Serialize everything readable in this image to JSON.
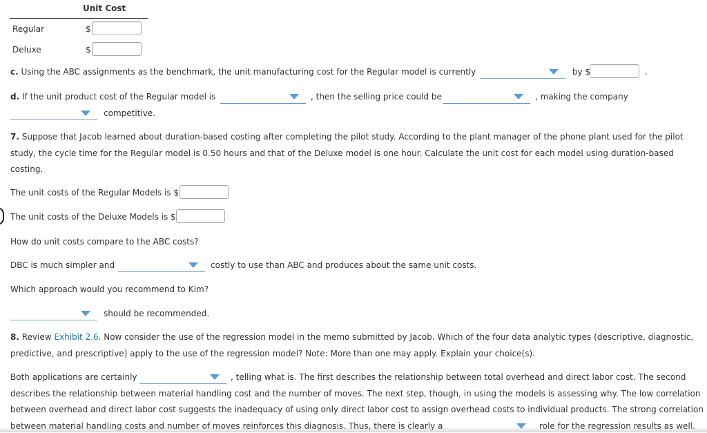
{
  "unit_cost_table": {
    "header": "Unit Cost",
    "rows": [
      {
        "label": "Regular",
        "currency": "$",
        "value": ""
      },
      {
        "label": "Deluxe",
        "currency": "$",
        "value": ""
      }
    ]
  },
  "part_c": {
    "prefix": "c.",
    "text": "Using the ABC assignments as the benchmark, the unit manufacturing cost for the Regular model is currently",
    "dropdown_value": "",
    "by_label": "by $",
    "amount_value": "",
    "suffix": "."
  },
  "part_d": {
    "prefix": "d.",
    "text1": "If the unit product cost of the Regular model is",
    "dropdown1_value": "",
    "text2": ", then the selling price could be",
    "dropdown2_value": "",
    "text3": ", making the company",
    "dropdown3_value": "",
    "text4": "competitive."
  },
  "question_7": {
    "number": "7.",
    "text": "Suppose that Jacob learned about duration-based costing after completing the pilot study. According to the plant manager of the phone plant used for the pilot study, the cycle time for the Regular model is 0.50 hours and that of the Deluxe model is one hour. Calculate the unit cost for each model using duration-based costing.",
    "regular_label": "The unit costs of the Regular Models is $",
    "regular_value": "",
    "deluxe_label": "The unit costs of the Deluxe Models is $",
    "deluxe_value": "",
    "compare_question": "How do unit costs compare to the ABC costs?",
    "dbc_text1": "DBC is much simpler and",
    "dbc_dropdown_value": "",
    "dbc_text2": "costly to use than ABC and produces about the same unit costs.",
    "recommend_question": "Which approach would you recommend to Kim?",
    "recommend_dropdown_value": "",
    "recommend_suffix": "should be recommended."
  },
  "question_8": {
    "number": "8.",
    "text_before_link": "Review",
    "link_text": "Exhibit 2.6",
    "text_after_link": ". Now consider the use of the regression model in the memo submitted by Jacob. Which of the four data analytic types (descriptive, diagnostic, predictive, and prescriptive) apply to the use of the regression model? Note: More than one may apply. Explain your choice(s).",
    "answer_text1": "Both applications are certainly",
    "answer_dropdown1_value": "",
    "answer_text2": ", telling what is. The first describes the relationship between total overhead and direct labor cost. The second",
    "answer_line2": "describes the relationship between material handling cost and the number of moves. The next step, though, in using the models is assessing why. The low correlation",
    "answer_line3": "between overhead and direct labor cost suggests the inadequacy of using only direct labor cost to assign overhead costs to individual products. The strong correlation",
    "answer_line4a": "between material handling costs and number of moves reinforces this diagnosis. Thus, there is clearly a",
    "answer_dropdown2_value": "",
    "answer_line4b": "role for the regression results as well."
  },
  "colors": {
    "dropdown_arrow": "#5b9bd5",
    "dropdown_underline": "#2e74b5",
    "link": "#1f6fbf",
    "text": "#333333"
  }
}
